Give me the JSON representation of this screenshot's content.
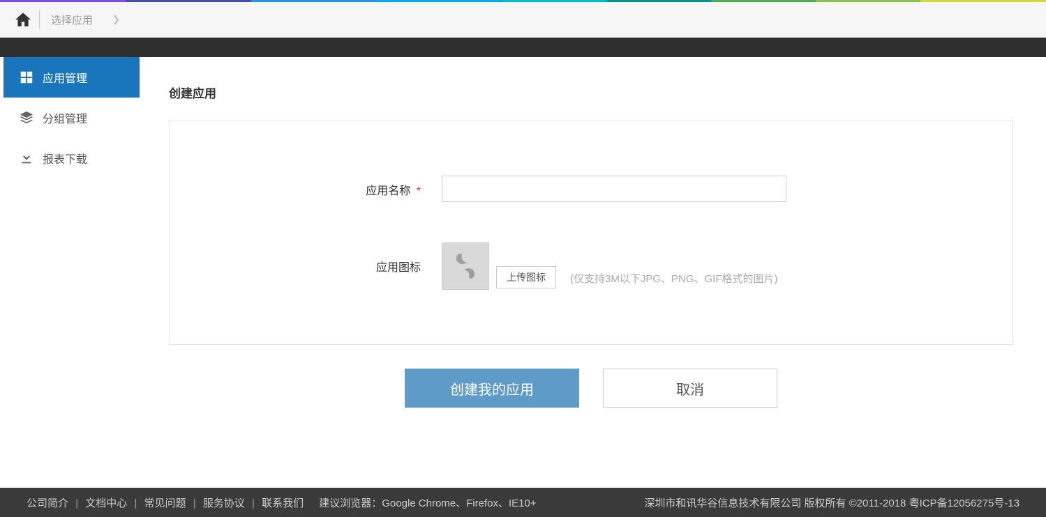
{
  "breadcrumb": {
    "current": "选择应用"
  },
  "sidebar": {
    "items": [
      {
        "label": "应用管理"
      },
      {
        "label": "分组管理"
      },
      {
        "label": "报表下载"
      }
    ]
  },
  "page": {
    "title": "创建应用"
  },
  "form": {
    "app_name_label": "应用名称",
    "app_name_value": "",
    "app_icon_label": "应用图标",
    "upload_button": "上传图标",
    "upload_hint": "(仅支持3M以下JPG、PNG、GIF格式的图片)"
  },
  "actions": {
    "create": "创建我的应用",
    "cancel": "取消"
  },
  "footer": {
    "links": {
      "about": "公司简介",
      "docs": "文档中心",
      "faq": "常见问题",
      "tos": "服务协议",
      "contact": "联系我们"
    },
    "browser": "建议浏览器：Google Chrome、Firefox、IE10+",
    "copyright": "深圳市和讯华谷信息技术有限公司 版权所有 ©2011-2018 粤ICP备12056275号-13"
  }
}
